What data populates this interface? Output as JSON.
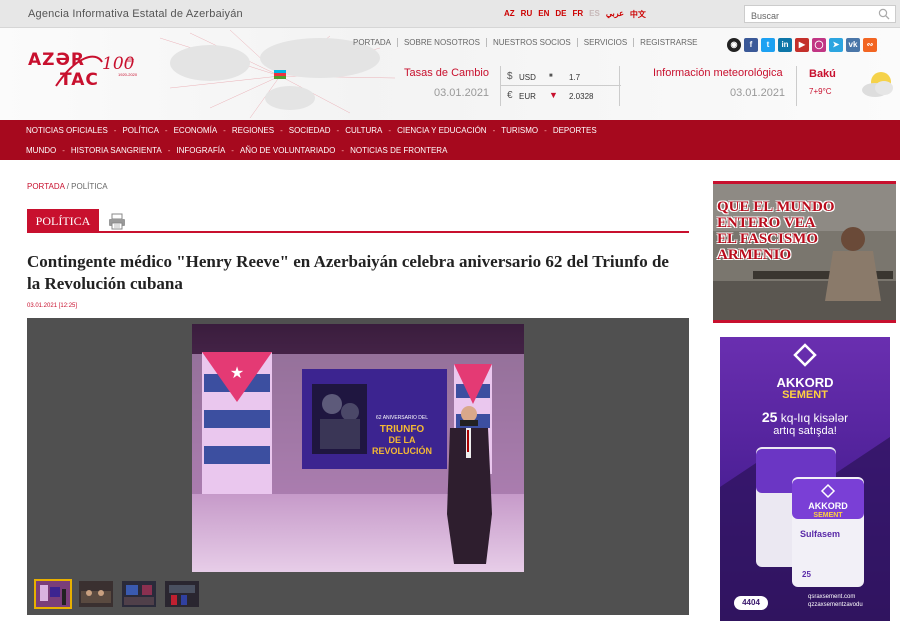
{
  "topbar": {
    "agency": "Agencia Informativa Estatal de Azerbaiyán",
    "languages": [
      "AZ",
      "RU",
      "EN",
      "DE",
      "FR",
      "ES",
      "عربي",
      "中文"
    ],
    "active_language": "ES",
    "search_placeholder": "Buscar"
  },
  "logo": {
    "line1": "AZƏR",
    "line2": "TAC",
    "anniversary": "100",
    "anniversary_word": "illik",
    "years": "1920-2020"
  },
  "header_nav": [
    "PORTADA",
    "SOBRE NOSOTROS",
    "NUESTROS SOCIOS",
    "SERVICIOS",
    "REGISTRARSE"
  ],
  "social_icons": [
    "eye-icon",
    "facebook-icon",
    "twitter-icon",
    "linkedin-icon",
    "youtube-icon",
    "instagram-icon",
    "telegram-icon",
    "vk-icon",
    "rss-icon"
  ],
  "exchange": {
    "title": "Tasas de Cambio",
    "date": "03.01.2021",
    "rows": [
      {
        "symbol": "$",
        "code": "USD",
        "trend": "flat",
        "value": "1.7"
      },
      {
        "symbol": "€",
        "code": "EUR",
        "trend": "down",
        "value": "2.0328"
      }
    ]
  },
  "weather": {
    "title": "Información meteorológica",
    "date": "03.01.2021",
    "city": "Bakú",
    "temp": "7+9°C"
  },
  "main_nav": {
    "row1": [
      "NOTICIAS OFICIALES",
      "POLÍTICA",
      "ECONOMÍA",
      "REGIONES",
      "SOCIEDAD",
      "CULTURA",
      "CIENCIA Y EDUCACIÓN",
      "TURISMO",
      "DEPORTES"
    ],
    "row2": [
      "MUNDO",
      "HISTORIA SANGRIENTA",
      "INFOGRAFÍA",
      "AÑO DE VOLUNTARIADO",
      "NOTICIAS DE FRONTERA"
    ]
  },
  "breadcrumb": {
    "home": "PORTADA",
    "separator": " / ",
    "current": "POLÍTICA"
  },
  "article": {
    "section": "POLÍTICA",
    "title": "Contingente médico \"Henry Reeve\" en Azerbaiyán celebra aniversario 62 del Triunfo de la Revolución cubana",
    "datetime": "03.01.2021 [12:25]",
    "photo_screen_text": {
      "small": "62 ANIVERSARIO DEL",
      "big1": "TRIUNFO",
      "big2": "DE LA",
      "big3": "REVOLUCIÓN"
    },
    "thumbnail_count": 4
  },
  "ads": {
    "ad1_text": [
      "QUE EL MUNDO",
      "ENTERO VEA",
      "EL FASCISMO",
      "ARMENIO"
    ],
    "ad2": {
      "brand1": "AKKORD",
      "brand2": "SEMENT",
      "promo_num": "25",
      "promo_rest": "kq-lıq kisələr",
      "promo_line2": "artıq satışda!",
      "bag_brand1": "AKKORD",
      "bag_brand2": "SEMENT",
      "bag_product": "Sulfasem",
      "bag_weight": "25",
      "phone": "4404",
      "website": "qsraxsement.com",
      "social": "qzzaxsementzavodu"
    }
  },
  "colors": {
    "brand_red": "#c8102e",
    "nav_red": "#a6091e",
    "ad_purple": "#4b1f95"
  }
}
